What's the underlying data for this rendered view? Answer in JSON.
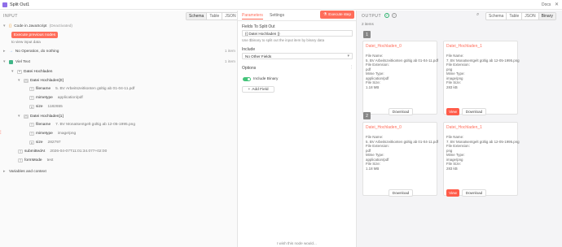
{
  "titlebar": {
    "title": "Split Out1",
    "docs": "Docs"
  },
  "left": {
    "header": "INPUT",
    "view_tabs": [
      "Schema",
      "Table",
      "JSON"
    ],
    "code_node": {
      "name": "Code in JavaScript",
      "status": "(Deactivated)",
      "button": "Execute previous nodes",
      "hint": "to view input data"
    },
    "noop_node": {
      "name": "No Operation, do nothing",
      "count": "1 item"
    },
    "viel_node": {
      "name": "Viel Text",
      "count": "1 item"
    },
    "tree": {
      "root": "Datei Hochladen",
      "item0": "Datei Hochladen[0]",
      "item1": "Datei Hochladen[1]",
      "filename_key": "filename",
      "filename0": "5. BV Arbeitszeitkonten gültig ab 01-04-11.pdf",
      "mimetype_key": "mimetype",
      "mimetype0": "application/pdf",
      "size_key": "size",
      "size0": "1182655",
      "filename1": "7. BV Monatsentgelt gültig ab 12-05-1995.png",
      "mimetype1": "image/png",
      "size1": "282797",
      "submitted_key": "submittedAt",
      "submitted_val": "2026-04-07T11:01:34.077+02:00",
      "formmode_key": "formMode",
      "formmode_val": "test"
    },
    "vars": "Variables and context"
  },
  "mid": {
    "tabs": [
      "Parameters",
      "Settings"
    ],
    "execute": "Execute step",
    "field_label": "Fields To Split Out",
    "field_value": "{{ Datei Hochladen }}",
    "field_hint": "Use $binary to split out the input item by binary data",
    "include_label": "Include",
    "include_value": "No Other Fields",
    "options_label": "Options",
    "toggle_label": "Include Binary",
    "add_field": "Add Field",
    "footer": "I wish this node would..."
  },
  "right": {
    "header": "OUTPUT",
    "count": "2 items",
    "view_tabs": [
      "Schema",
      "Table",
      "JSON",
      "Binary"
    ],
    "groups": [
      {
        "index": "1",
        "cards": [
          {
            "name": "Datei_Hochladen_0",
            "file_name": "5. BV Arbeitszeitkonten gültig ab 01-04-11.pdf",
            "ext": "pdf",
            "mime": "application/pdf",
            "size": "1.18 MB",
            "view": false
          },
          {
            "name": "Datei_Hochladen_1",
            "file_name": "7. BV Monatsentgelt gültig ab 12-05-1995.png",
            "ext": "png",
            "mime": "image/png",
            "size": "283 kB",
            "view": true
          }
        ]
      },
      {
        "index": "2",
        "cards": [
          {
            "name": "Datei_Hochladen_0",
            "file_name": "5. BV Arbeitszeitkonten gültig ab 01-04-11.pdf",
            "ext": "pdf",
            "mime": "application/pdf",
            "size": "1.18 MB",
            "view": false
          },
          {
            "name": "Datei_Hochladen_1",
            "file_name": "7. BV Monatsentgelt gültig ab 12-05-1995.png",
            "ext": "png",
            "mime": "image/png",
            "size": "283 kB",
            "view": true
          }
        ]
      }
    ],
    "labels": {
      "file_name": "File Name:",
      "ext": "File Extension:",
      "mime": "Mime Type:",
      "size": "File Size:",
      "download": "Download",
      "view": "View"
    }
  },
  "colors": {
    "accent": "#ff6d5a",
    "toggle": "#44c47a"
  }
}
